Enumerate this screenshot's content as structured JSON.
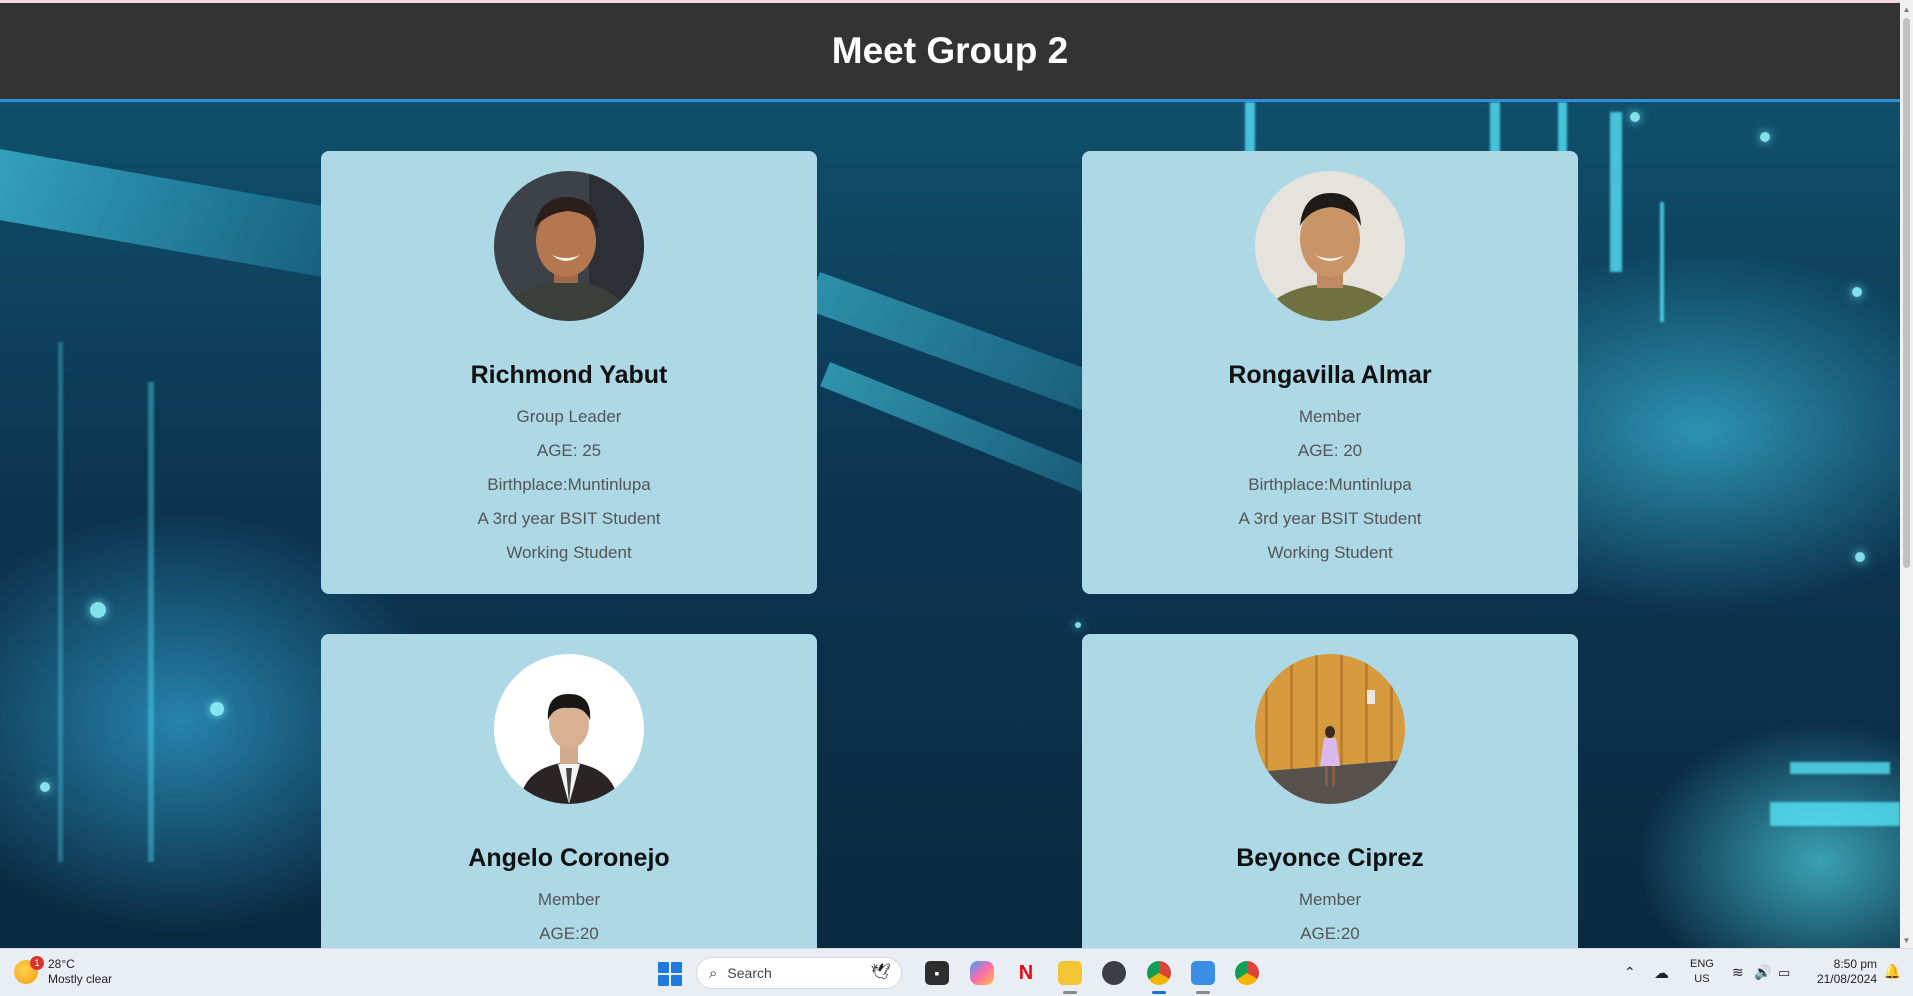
{
  "page": {
    "title": "Meet Group 2"
  },
  "members": [
    {
      "name": "Richmond Yabut",
      "role": "Group Leader",
      "age": "AGE: 25",
      "birthplace": "Birthplace:Muntinlupa",
      "year": "A 3rd year BSIT Student",
      "status": "Working Student"
    },
    {
      "name": "Rongavilla Almar",
      "role": "Member",
      "age": "AGE: 20",
      "birthplace": "Birthplace:Muntinlupa",
      "year": "A 3rd year BSIT Student",
      "status": "Working Student"
    },
    {
      "name": "Angelo Coronejo",
      "role": "Member",
      "age": "AGE:20"
    },
    {
      "name": "Beyonce Ciprez",
      "role": "Member",
      "age": "AGE:20"
    }
  ],
  "taskbar": {
    "weather": {
      "badge": "1",
      "temp": "28°C",
      "condition": "Mostly clear"
    },
    "search_placeholder": "Search",
    "apps": [
      "terminal-app-icon",
      "copilot-app-icon",
      "netflix-app-icon",
      "file-explorer-app-icon",
      "obs-app-icon",
      "chrome-app-icon",
      "notepad-app-icon",
      "chrome-profile-app-icon"
    ],
    "netflix_label": "N",
    "lang": "ENG",
    "region": "US",
    "time": "8:50 pm",
    "date": "21/08/2024"
  },
  "colors": {
    "header": "#333333",
    "card": "#add8e6",
    "accent": "#2f8fd8"
  }
}
